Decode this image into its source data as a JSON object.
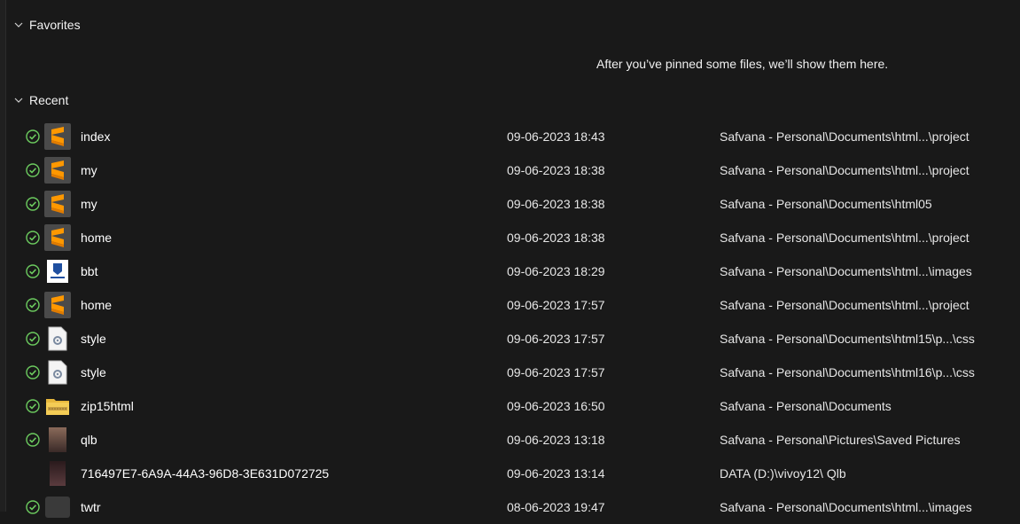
{
  "favorites": {
    "label": "Favorites",
    "empty_message": "After you’ve pinned some files, we’ll show them here."
  },
  "recent": {
    "label": "Recent",
    "items": [
      {
        "name": "index",
        "date": "09-06-2023 18:43",
        "location": "Safvana - Personal\\Documents\\html...\\project",
        "icon": "sublime-text-icon",
        "synced": true
      },
      {
        "name": "my",
        "date": "09-06-2023 18:38",
        "location": "Safvana - Personal\\Documents\\html...\\project",
        "icon": "sublime-text-icon",
        "synced": true
      },
      {
        "name": "my",
        "date": "09-06-2023 18:38",
        "location": "Safvana - Personal\\Documents\\html05",
        "icon": "sublime-text-icon",
        "synced": true
      },
      {
        "name": "home",
        "date": "09-06-2023 18:38",
        "location": "Safvana - Personal\\Documents\\html...\\project",
        "icon": "sublime-text-icon",
        "synced": true
      },
      {
        "name": "bbt",
        "date": "09-06-2023 18:29",
        "location": "Safvana - Personal\\Documents\\html...\\images",
        "icon": "image-thumbnail-icon",
        "synced": true
      },
      {
        "name": "home",
        "date": "09-06-2023 17:57",
        "location": "Safvana - Personal\\Documents\\html...\\project",
        "icon": "sublime-text-icon",
        "synced": true
      },
      {
        "name": "style",
        "date": "09-06-2023 17:57",
        "location": "Safvana - Personal\\Documents\\html15\\p...\\css",
        "icon": "settings-file-icon",
        "synced": true
      },
      {
        "name": "style",
        "date": "09-06-2023 17:57",
        "location": "Safvana - Personal\\Documents\\html16\\p...\\css",
        "icon": "settings-file-icon",
        "synced": true
      },
      {
        "name": "zip15html",
        "date": "09-06-2023 16:50",
        "location": "Safvana - Personal\\Documents",
        "icon": "zip-folder-icon",
        "synced": true
      },
      {
        "name": "qlb",
        "date": "09-06-2023 13:18",
        "location": "Safvana - Personal\\Pictures\\Saved Pictures",
        "icon": "photo-thumbnail-icon",
        "synced": true
      },
      {
        "name": "716497E7-6A9A-44A3-96D8-3E631D072725",
        "date": "09-06-2023 13:14",
        "location": "DATA (D:)\\vivoy12\\ Qlb",
        "icon": "photo-thumbnail-icon",
        "synced": false
      },
      {
        "name": "twtr",
        "date": "08-06-2023 19:47",
        "location": "Safvana - Personal\\Documents\\html...\\images",
        "icon": "image-thumbnail-icon",
        "synced": true
      }
    ]
  },
  "colors": {
    "background": "#191919",
    "sync_green": "#6ccb5f",
    "sublime_orange": "#ff9800"
  }
}
